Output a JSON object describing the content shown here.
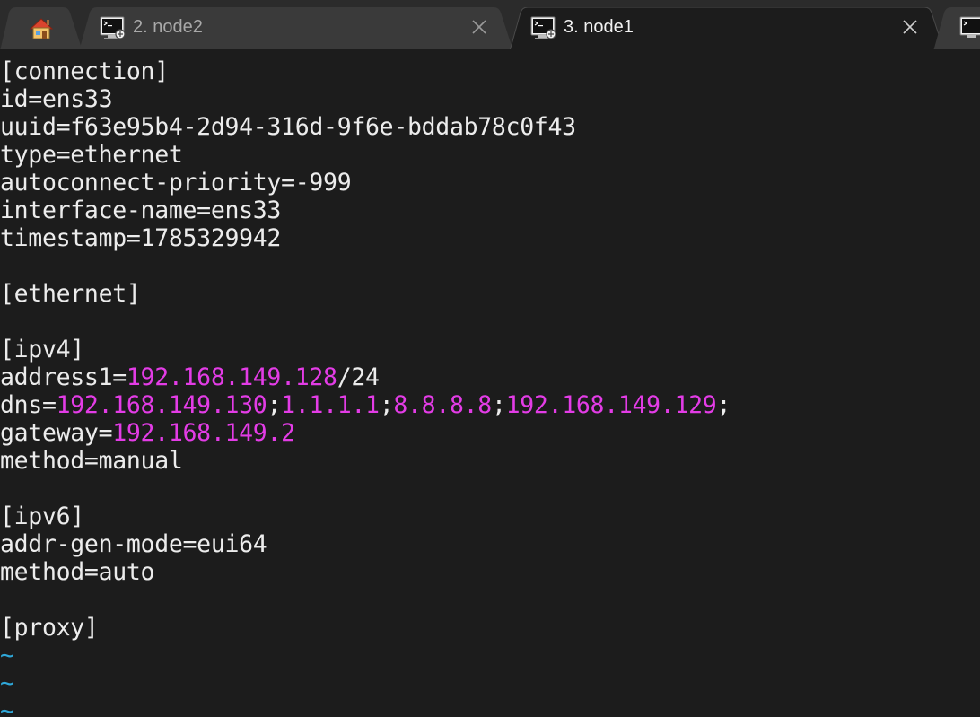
{
  "tabs": [
    {
      "id": "home",
      "title": "",
      "icon": "home-icon",
      "active": false
    },
    {
      "id": "node2",
      "title": "2. node2",
      "icon": "terminal-icon",
      "active": false
    },
    {
      "id": "node1",
      "title": "3. node1",
      "icon": "terminal-icon",
      "active": true
    },
    {
      "id": "next",
      "title": "",
      "icon": "terminal-icon",
      "active": false
    }
  ],
  "colors": {
    "background": "#1c1c1c",
    "text": "#ececec",
    "value_highlight": "#e33ce6",
    "tilde": "#2fa7d8",
    "tabbar": "#2b2b2b",
    "active_tab": "#1c1c1c",
    "inactive_tab": "#3a3a3a"
  },
  "editor": {
    "lines": {
      "l1": "[connection]",
      "l2": "id=ens33",
      "l3": "uuid=f63e95b4-2d94-316d-9f6e-bddab78c0f43",
      "l4": "type=ethernet",
      "l5": "autoconnect-priority=-999",
      "l6": "interface-name=ens33",
      "l7": "timestamp=1785329942",
      "l9": "[ethernet]",
      "l11": "[ipv4]",
      "l12": {
        "key": "address1=",
        "ip": "192.168.149.128",
        "suffix": "/24"
      },
      "l13": {
        "key": "dns=",
        "dns1": "192.168.149.130",
        "sep1": ";",
        "dns2": "1.1.1.1",
        "sep2": ";",
        "dns3": "8.8.8.8",
        "sep3": ";",
        "dns4": "192.168.149.129",
        "sep4": ";"
      },
      "l14": {
        "key": "gateway=",
        "ip": "192.168.149.2"
      },
      "l15": "method=manual",
      "l17": "[ipv6]",
      "l18": "addr-gen-mode=eui64",
      "l19": "method=auto",
      "l21": "[proxy]",
      "tilde": "~"
    }
  }
}
